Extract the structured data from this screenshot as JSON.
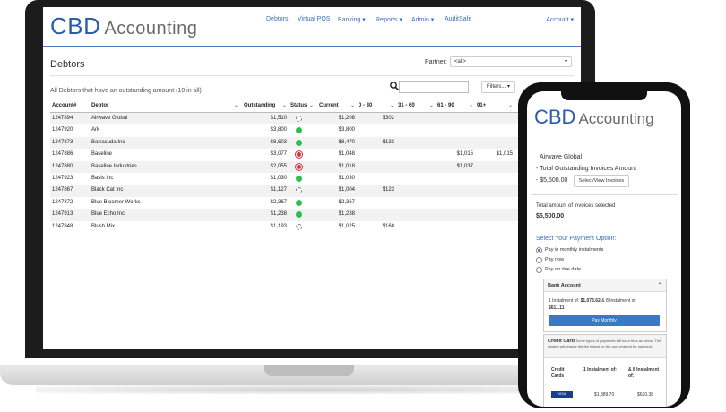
{
  "app": {
    "logo_brand": "CBD",
    "logo_suffix": "Accounting"
  },
  "nav": {
    "items": [
      "Debtors",
      "Virtual POS",
      "Banking ▾",
      "Reports ▾",
      "Admin ▾",
      "AuditSafe"
    ],
    "account": "Account ▾"
  },
  "page": {
    "title": "Debtors",
    "partner_label": "Partner:",
    "partner_value": "<all>",
    "summary": "All Debtors that have an outstanding amount (10 in all)",
    "filters_label": "Filters... ▾"
  },
  "table": {
    "columns": [
      "Account#",
      "Debtor",
      "Outstanding",
      "Status",
      "Current",
      "0 - 30",
      "31 - 60",
      "61 - 90",
      "91+"
    ],
    "rows": [
      {
        "acct": "1247894",
        "debtor": "Airwave Global",
        "out": "$1,510",
        "status": "pending",
        "current": "$1,208",
        "d0": "$302",
        "d31": "",
        "d61": "",
        "d91": ""
      },
      {
        "acct": "1247920",
        "debtor": "Ark",
        "out": "$3,800",
        "status": "green",
        "current": "$3,800",
        "d0": "",
        "d31": "",
        "d61": "",
        "d91": ""
      },
      {
        "acct": "1247873",
        "debtor": "Barracuda Inc",
        "out": "$8,603",
        "status": "green",
        "current": "$8,470",
        "d0": "$133",
        "d31": "",
        "d61": "",
        "d91": ""
      },
      {
        "acct": "1247886",
        "debtor": "Baseline",
        "out": "$3,077",
        "status": "red",
        "current": "$1,048",
        "d0": "",
        "d31": "",
        "d61": "$1,015",
        "d91": "$1,015"
      },
      {
        "acct": "1247880",
        "debtor": "Baseline Industries",
        "out": "$2,055",
        "status": "red",
        "current": "$1,018",
        "d0": "",
        "d31": "",
        "d61": "$1,037",
        "d91": ""
      },
      {
        "acct": "1247923",
        "debtor": "Basis Inc",
        "out": "$1,030",
        "status": "green",
        "current": "$1,030",
        "d0": "",
        "d31": "",
        "d61": "",
        "d91": ""
      },
      {
        "acct": "1247867",
        "debtor": "Black Cat Inc",
        "out": "$1,127",
        "status": "pending",
        "current": "$1,004",
        "d0": "$123",
        "d31": "",
        "d61": "",
        "d91": ""
      },
      {
        "acct": "1247872",
        "debtor": "Blue Bloomer Works",
        "out": "$2,367",
        "status": "green",
        "current": "$2,367",
        "d0": "",
        "d31": "",
        "d61": "",
        "d91": ""
      },
      {
        "acct": "1247913",
        "debtor": "Blue Echo Inc",
        "out": "$1,238",
        "status": "green",
        "current": "$1,238",
        "d0": "",
        "d31": "",
        "d61": "",
        "d91": ""
      },
      {
        "acct": "1247848",
        "debtor": "Blush Mix",
        "out": "$1,193",
        "status": "pending",
        "current": "$1,025",
        "d0": "$168",
        "d31": "",
        "d61": "",
        "d91": ""
      }
    ]
  },
  "phone": {
    "debtor_name": "Airwave Global",
    "total_label": "- Total Outstanding Invoices Amount",
    "total_value": "- $5,500.00",
    "select_btn": "Select/View Invoices",
    "selected_label": "Total amount of invoices selected",
    "selected_value": "$5,500.00",
    "payment_heading": "Select Your Payment Option:",
    "options": [
      "Pay in monthly instalments",
      "Pay now",
      "Pay on due date"
    ],
    "bank": {
      "title": "Bank Account",
      "text_a": "1 Instalment of: ",
      "amount_a": "$1,073.62",
      "text_b": " & 8 Instalment of:",
      "amount_b": "$611.11",
      "button": "Pay Monthly"
    },
    "card": {
      "title": "Credit Card",
      "note": "Some types of payments will incur fees as below. The system will charge the fee based on the card entered for payment.",
      "col1": "Credit Cards",
      "col2": "1 Instalment of:",
      "col3": "& 8 Instalment of:",
      "val2": "$1,389.70",
      "val3": "$620.38",
      "logos": "VISA"
    }
  },
  "colors": {
    "brand_blue": "#2b5da8",
    "link_blue": "#3a6fbf",
    "status_green": "#2bbf4d",
    "status_red": "#e02a36"
  }
}
